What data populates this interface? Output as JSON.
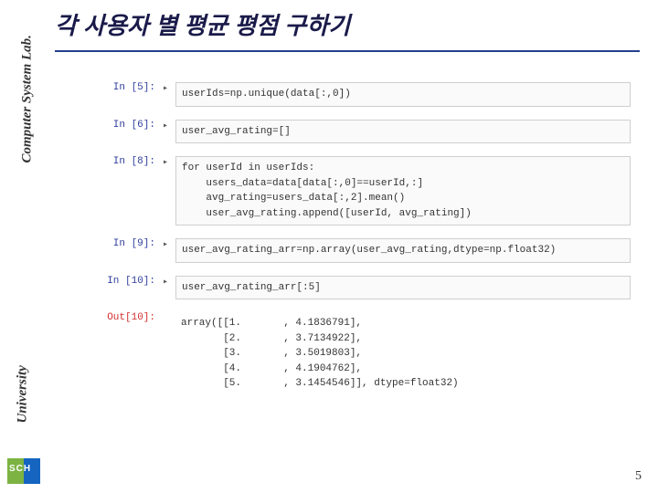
{
  "sidebar": {
    "lab": "Computer System Lab.",
    "university": "University",
    "logo": "SCH"
  },
  "title": "각 사용자 별 평균 평점 구하기",
  "cells": [
    {
      "prompt": "In [5]:",
      "type": "in",
      "lines": [
        "userIds=np.unique(data[:,0])"
      ]
    },
    {
      "prompt": "In [6]:",
      "type": "in",
      "lines": [
        "user_avg_rating=[]"
      ]
    },
    {
      "prompt": "In [8]:",
      "type": "in",
      "lines": [
        "for userId in userIds:",
        "    users_data=data[data[:,0]==userId,:]",
        "    avg_rating=users_data[:,2].mean()",
        "    user_avg_rating.append([userId, avg_rating])"
      ]
    },
    {
      "prompt": "In [9]:",
      "type": "in",
      "lines": [
        "user_avg_rating_arr=np.array(user_avg_rating,dtype=np.float32)"
      ]
    },
    {
      "prompt": "In [10]:",
      "type": "in",
      "lines": [
        "user_avg_rating_arr[:5]"
      ]
    },
    {
      "prompt": "Out[10]:",
      "type": "out",
      "lines": [
        "array([[1.       , 4.1836791],",
        "       [2.       , 3.7134922],",
        "       [3.       , 3.5019803],",
        "       [4.       , 4.1904762],",
        "       [5.       , 3.1454546]], dtype=float32)"
      ]
    }
  ],
  "page": "5"
}
